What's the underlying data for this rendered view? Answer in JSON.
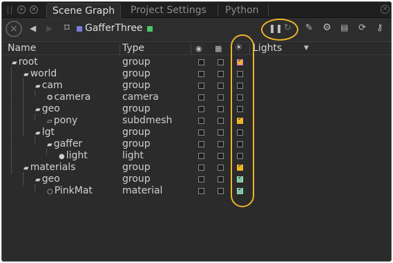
{
  "tabs": [
    {
      "label": "Scene Graph"
    },
    {
      "label": "Project Settings"
    },
    {
      "label": "Python"
    }
  ],
  "toolbar": {
    "node_name": "GafferThree",
    "colors": {
      "node_swatch": "#7b7bde",
      "node_status": "#4cc46a",
      "highlight": "#f0b429"
    },
    "icons": [
      "close-circle-icon",
      "back-arrow-icon",
      "forward-arrow-icon",
      "node-graph-icon",
      "pause-icon",
      "refresh-icon",
      "pencil-icon",
      "gear-icon",
      "clapper-icon",
      "sync-icon",
      "key-icon"
    ]
  },
  "columns": {
    "name": "Name",
    "type": "Type",
    "lights": "Lights",
    "icons": [
      "viewer-visibility-icon",
      "render-icon",
      "light-icon"
    ]
  },
  "rows": [
    {
      "name": "root",
      "type": "group",
      "depth": 0,
      "icon": "group",
      "c1": false,
      "c2": false,
      "c3": "pink"
    },
    {
      "name": "world",
      "type": "group",
      "depth": 1,
      "icon": "group",
      "c1": false,
      "c2": false,
      "c3": "off"
    },
    {
      "name": "cam",
      "type": "group",
      "depth": 2,
      "icon": "group",
      "c1": false,
      "c2": false,
      "c3": "off"
    },
    {
      "name": "camera",
      "type": "camera",
      "depth": 3,
      "icon": "camera",
      "c1": false,
      "c2": false,
      "c3": "off"
    },
    {
      "name": "geo",
      "type": "group",
      "depth": 2,
      "icon": "group",
      "c1": false,
      "c2": false,
      "c3": "off"
    },
    {
      "name": "pony",
      "type": "subdmesh",
      "depth": 3,
      "icon": "mesh",
      "c1": false,
      "c2": false,
      "c3": "on"
    },
    {
      "name": "lgt",
      "type": "group",
      "depth": 2,
      "icon": "group",
      "c1": false,
      "c2": false,
      "c3": "off"
    },
    {
      "name": "gaffer",
      "type": "group",
      "depth": 3,
      "icon": "group",
      "c1": false,
      "c2": false,
      "c3": "off"
    },
    {
      "name": "light",
      "type": "light",
      "depth": 4,
      "icon": "light",
      "c1": false,
      "c2": false,
      "c3": "off"
    },
    {
      "name": "materials",
      "type": "group",
      "depth": 1,
      "icon": "group",
      "c1": false,
      "c2": false,
      "c3": "on"
    },
    {
      "name": "geo",
      "type": "group",
      "depth": 2,
      "icon": "group",
      "c1": false,
      "c2": false,
      "c3": "green"
    },
    {
      "name": "PinkMat",
      "type": "material",
      "depth": 3,
      "icon": "material",
      "c1": false,
      "c2": false,
      "c3": "green"
    }
  ]
}
